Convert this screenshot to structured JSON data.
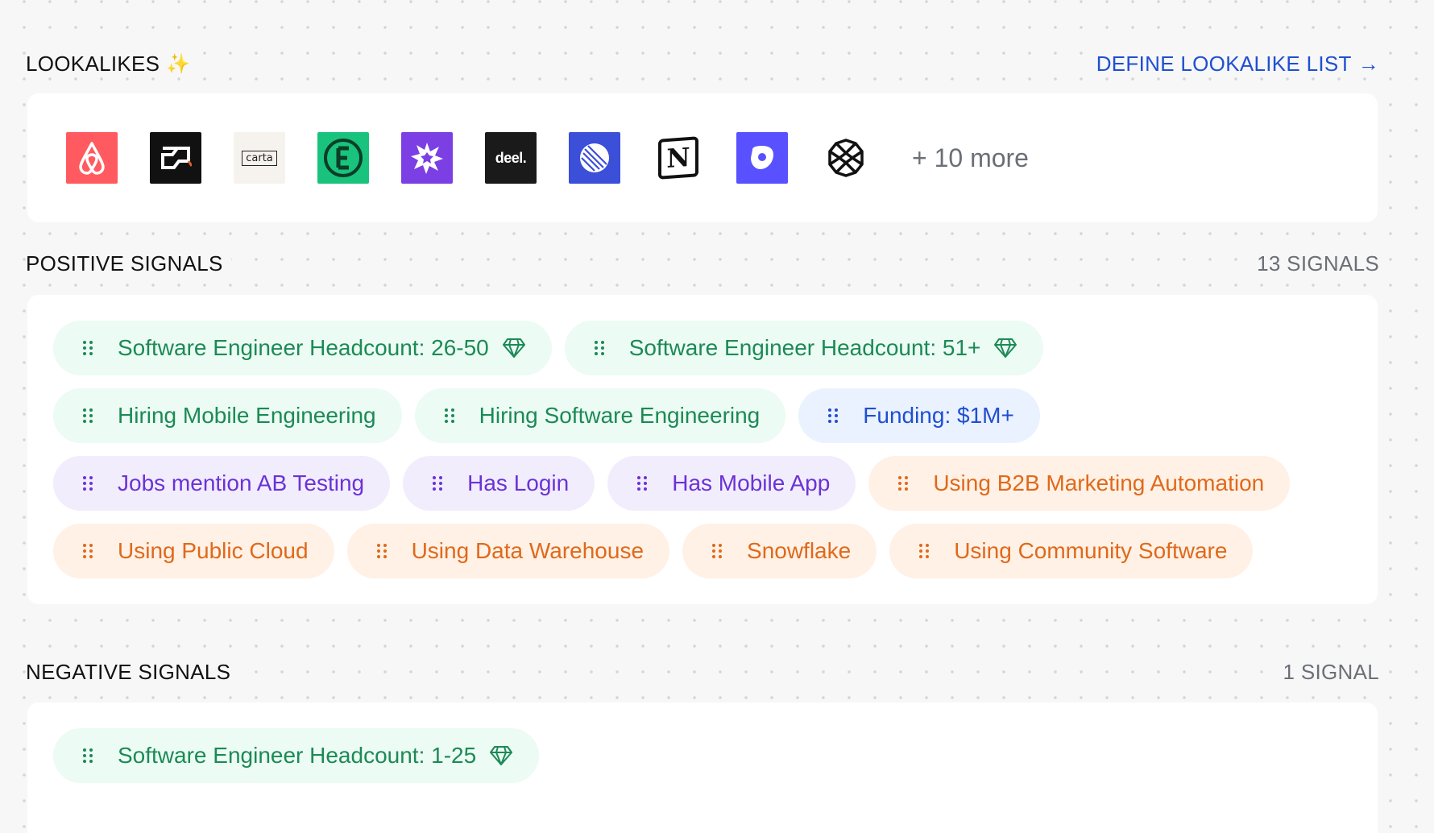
{
  "lookalikes": {
    "title": "LOOKALIKES",
    "sparkle": "✨",
    "define_link": "DEFINE LOOKALIKE LIST",
    "define_arrow": "→",
    "logos": [
      {
        "name": "airbnb",
        "bg": "#ff5a5f"
      },
      {
        "name": "brex",
        "bg": "#111111"
      },
      {
        "name": "carta",
        "bg": "#f6f3ef",
        "text": "carta"
      },
      {
        "name": "expensify",
        "bg": "#19c37d"
      },
      {
        "name": "starburst",
        "bg": "#7b3fe4"
      },
      {
        "name": "deel",
        "bg": "#1a1a1a",
        "text": "deel."
      },
      {
        "name": "linear",
        "bg": "#3b4fd8"
      },
      {
        "name": "notion",
        "bg": "#ffffff",
        "text": "N"
      },
      {
        "name": "outreach",
        "bg": "#5951ff"
      },
      {
        "name": "plaid",
        "bg": "#ffffff"
      }
    ],
    "more_text": "+ 10 more"
  },
  "positive": {
    "title": "POSITIVE SIGNALS",
    "count": "13 SIGNALS",
    "chips": [
      {
        "label": "Software Engineer Headcount: 26-50",
        "color": "green",
        "gem": true
      },
      {
        "label": "Software Engineer Headcount: 51+",
        "color": "green",
        "gem": true
      },
      {
        "label": "Hiring Mobile Engineering",
        "color": "green",
        "gem": false
      },
      {
        "label": "Hiring Software Engineering",
        "color": "green",
        "gem": false
      },
      {
        "label": "Funding: $1M+",
        "color": "blue",
        "gem": false
      },
      {
        "label": "Jobs mention AB Testing",
        "color": "purple",
        "gem": false
      },
      {
        "label": "Has Login",
        "color": "purple",
        "gem": false
      },
      {
        "label": "Has Mobile App",
        "color": "purple",
        "gem": false
      },
      {
        "label": "Using B2B Marketing Automation",
        "color": "orange",
        "gem": false
      },
      {
        "label": "Using Public Cloud",
        "color": "orange",
        "gem": false
      },
      {
        "label": "Using Data Warehouse",
        "color": "orange",
        "gem": false
      },
      {
        "label": "Snowflake",
        "color": "orange",
        "gem": false
      },
      {
        "label": "Using Community Software",
        "color": "orange",
        "gem": false
      }
    ]
  },
  "negative": {
    "title": "NEGATIVE SIGNALS",
    "count": "1 SIGNAL",
    "chips": [
      {
        "label": "Software Engineer Headcount: 1-25",
        "color": "green",
        "gem": true
      }
    ]
  }
}
